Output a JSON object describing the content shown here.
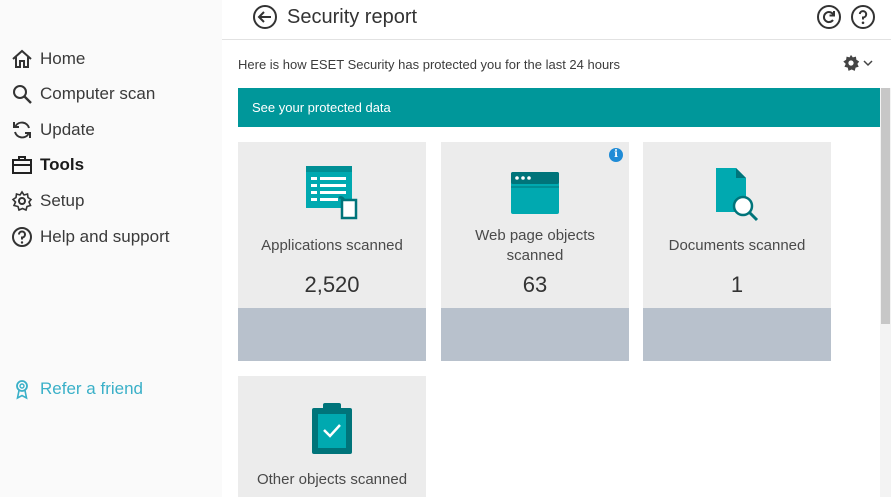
{
  "sidebar": {
    "items": [
      {
        "label": "Home",
        "icon": "home-icon"
      },
      {
        "label": "Computer scan",
        "icon": "search-icon"
      },
      {
        "label": "Update",
        "icon": "refresh-icon"
      },
      {
        "label": "Tools",
        "icon": "briefcase-icon"
      },
      {
        "label": "Setup",
        "icon": "gear-icon"
      },
      {
        "label": "Help and support",
        "icon": "help-icon"
      }
    ],
    "active": "Tools",
    "refer": {
      "label": "Refer a friend",
      "icon": "award-icon"
    }
  },
  "header": {
    "title": "Security report"
  },
  "main": {
    "subtitle": "Here is how ESET Security has protected you for the last 24 hours",
    "banner": "See your protected data",
    "cards": [
      {
        "label": "Applications scanned",
        "value": "2,520"
      },
      {
        "label": "Web page objects scanned",
        "value": "63"
      },
      {
        "label": "Documents scanned",
        "value": "1"
      },
      {
        "label": "Other objects scanned",
        "value": ""
      }
    ],
    "info_badge": "i"
  },
  "colors": {
    "accent": "#00979a",
    "link": "#3ab0c8",
    "icon_teal": "#00a9b0",
    "card_bg": "#ececec",
    "card_bar": "#b8c1cc"
  }
}
